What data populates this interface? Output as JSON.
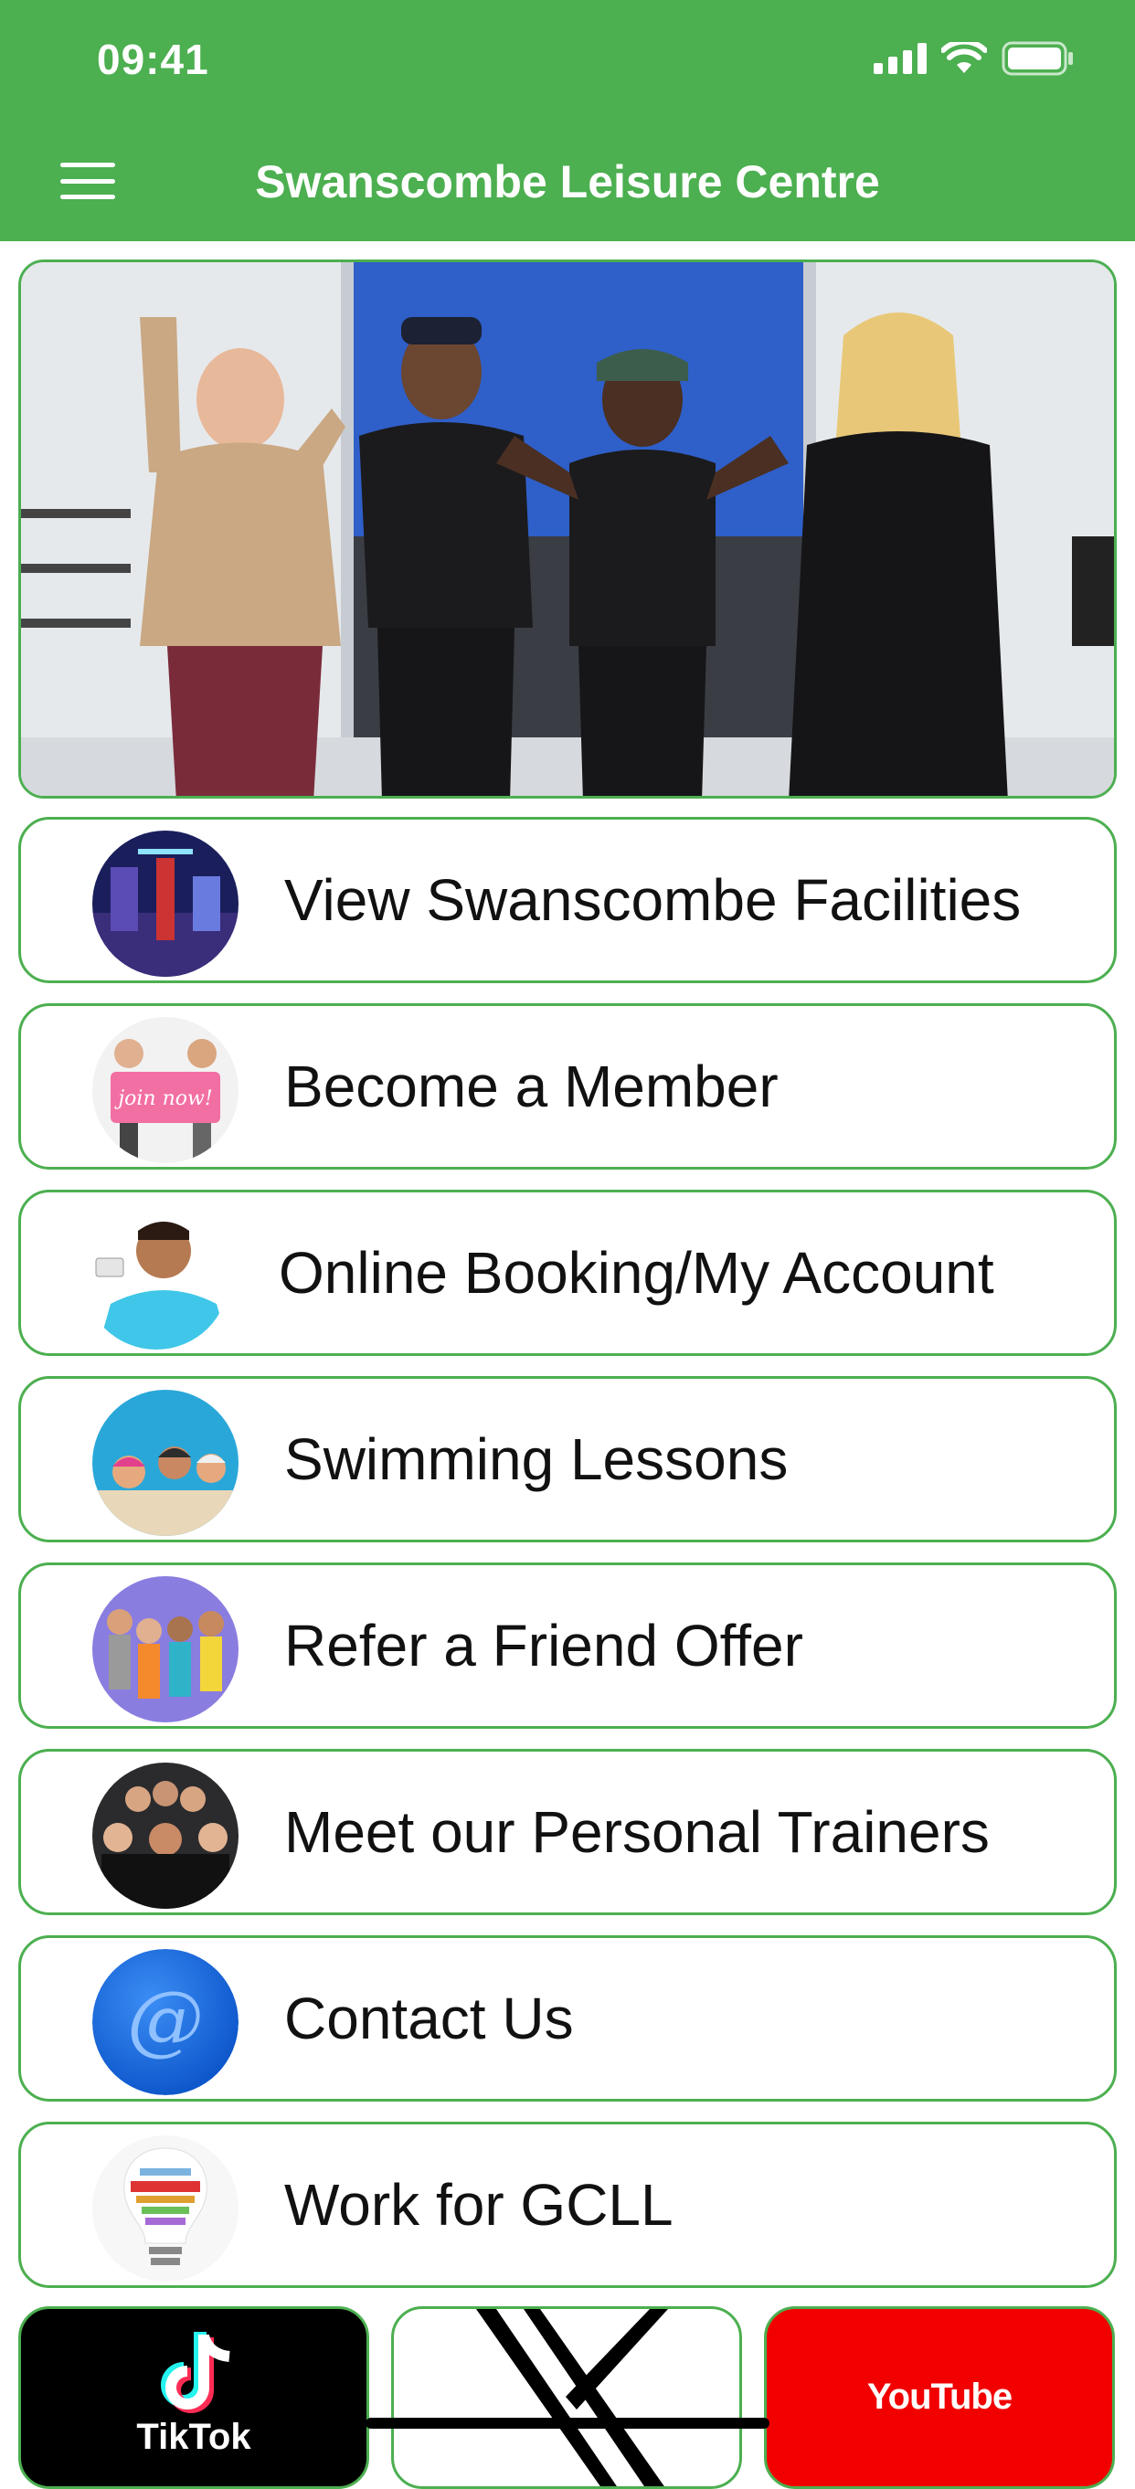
{
  "status_bar": {
    "time": "09:41"
  },
  "nav": {
    "title": "Swanscombe Leisure Centre"
  },
  "menu": [
    {
      "label": "View Swanscombe Facilities",
      "thumb": "gym-facility-photo"
    },
    {
      "label": "Become a Member",
      "thumb": "join-now-photo"
    },
    {
      "label": "Online Booking/My Account",
      "thumb": "man-holding-card-photo"
    },
    {
      "label": "Swimming Lessons",
      "thumb": "swimmers-pool-photo"
    },
    {
      "label": "Refer a Friend Offer",
      "thumb": "group-of-friends-photo"
    },
    {
      "label": "Meet our Personal Trainers",
      "thumb": "trainers-team-photo"
    },
    {
      "label": "Contact Us",
      "thumb": "at-sign-icon"
    },
    {
      "label": "Work for GCLL",
      "thumb": "careers-lightbulb-photo"
    }
  ],
  "social": {
    "tiktok_label": "TikTok",
    "youtube_label": "YouTube"
  },
  "colors": {
    "brand_green": "#4caf50",
    "youtube_red": "#f20000",
    "tiktok_black": "#000000"
  }
}
